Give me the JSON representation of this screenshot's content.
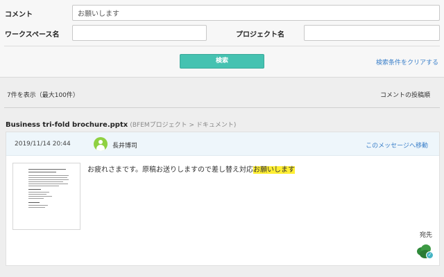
{
  "search": {
    "comment_label": "コメント",
    "comment_value": "お願いします",
    "workspace_label": "ワークスペース名",
    "workspace_value": "",
    "project_label": "プロジェクト名",
    "project_value": "",
    "search_button": "検索",
    "clear_link": "検索条件をクリアする"
  },
  "results": {
    "count_text": "7件を表示（最大100件）",
    "sort_label": "コメントの投稿順"
  },
  "document": {
    "name": "Business tri-fold brochure.pptx",
    "path": "(BFEMプロジェクト > ドキュメント)"
  },
  "comment": {
    "date": "2019/11/14 20:44",
    "user": "長井博司",
    "goto_link": "このメッセージへ移動",
    "text_before": "お疲れさまです。原稿お送りしますので差し替え対応",
    "text_highlight": "お願いします",
    "recipients_label": "宛先"
  },
  "colors": {
    "accent": "#45c2b1",
    "link": "#3a7fc9",
    "highlight": "#ffee33",
    "card_header": "#eef6fb"
  },
  "icons": {
    "user_avatar": "default-user-avatar-icon",
    "recipient_avatar": "tree-avatar-icon",
    "recipient_check": "check-badge-icon"
  }
}
